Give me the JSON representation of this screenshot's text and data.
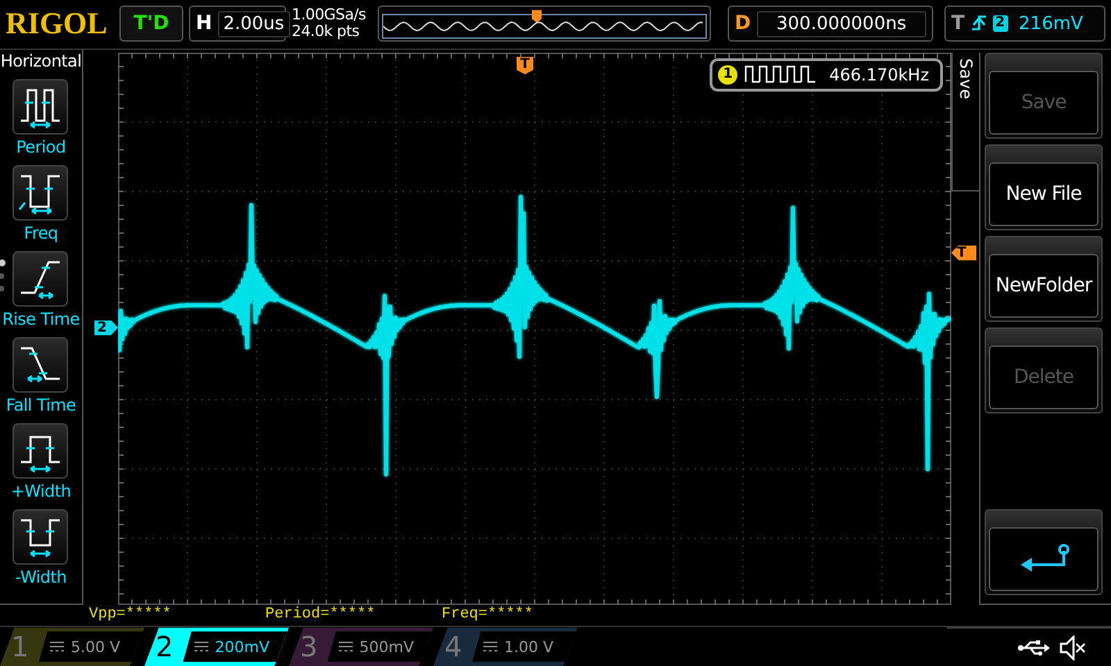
{
  "top_bar": {
    "logo": "RIGOL",
    "run_state": "T'D",
    "horizontal": {
      "label": "H",
      "value": "2.00us"
    },
    "sample_rate": "1.00GSa/s",
    "memory_depth": "24.0k pts",
    "delay": {
      "label": "D",
      "value": "300.000000ns"
    },
    "trigger": {
      "label": "T",
      "source": "2",
      "level": "216mV"
    }
  },
  "measure_menu": {
    "title": "Horizontal",
    "items": [
      {
        "label": "Period",
        "kind": "period"
      },
      {
        "label": "Freq",
        "kind": "freq"
      },
      {
        "label": "Rise Time",
        "kind": "rise"
      },
      {
        "label": "Fall Time",
        "kind": "fall"
      },
      {
        "label": "+Width",
        "kind": "pwidth"
      },
      {
        "label": "-Width",
        "kind": "nwidth"
      }
    ],
    "pages": [
      {
        "selected": true
      },
      {
        "selected": false
      },
      {
        "selected": false
      }
    ]
  },
  "plot": {
    "trigger_position_marker": "T",
    "trigger_level_marker": "T",
    "channel_marker": "2",
    "counter": {
      "channel": "1",
      "value": "466.170kHz"
    }
  },
  "measurements": [
    "Vpp=*****",
    "Period=*****",
    "Freq=*****"
  ],
  "save_menu": {
    "title": "Save",
    "buttons": [
      {
        "kind": "text",
        "label": "Save",
        "disabled": true
      },
      {
        "kind": "text",
        "label": "New File",
        "disabled": false
      },
      {
        "kind": "text",
        "label": "NewFolder",
        "disabled": false
      },
      {
        "kind": "text",
        "label": "Delete",
        "disabled": true
      },
      {
        "kind": "back"
      }
    ]
  },
  "channels": [
    {
      "number": "1",
      "scale": "5.00 V",
      "selected": false,
      "color": "#36360f"
    },
    {
      "number": "2",
      "scale": "200mV",
      "selected": true,
      "color": "#00ffff"
    },
    {
      "number": "3",
      "scale": "500mV",
      "selected": false,
      "color": "#361a36"
    },
    {
      "number": "4",
      "scale": "1.00 V",
      "selected": false,
      "color": "#1a2a3e"
    }
  ]
}
